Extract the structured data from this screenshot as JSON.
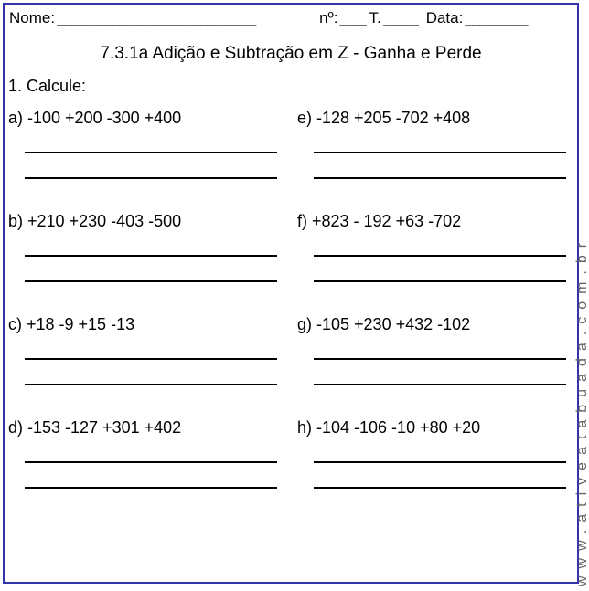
{
  "header": {
    "nome_label": "Nome:",
    "nome_dash": "_____________________________",
    "no_label": " nº:",
    "no_dash": "____",
    "t_label": " T.",
    "t_dash": "_____",
    "data_label": " Data:",
    "data_dash": "_________"
  },
  "title": "7.3.1a Adição e Subtração em Z - Ganha e Perde",
  "instruction": "1. Calcule:",
  "problems": {
    "a": "a) -100 +200 -300 +400",
    "b": "b) +210 +230 -403 -500",
    "c": "c) +18 -9 +15 -13",
    "d": "d) -153 -127 +301 +402",
    "e": "e) -128 +205 -702 +408",
    "f": " f) +823 - 192 +63 -702",
    "g": "g) -105 +230 +432 -102",
    "h": "h) -104 -106 -10 +80 +20"
  },
  "watermark": "www.ativeatabuada.com.br"
}
